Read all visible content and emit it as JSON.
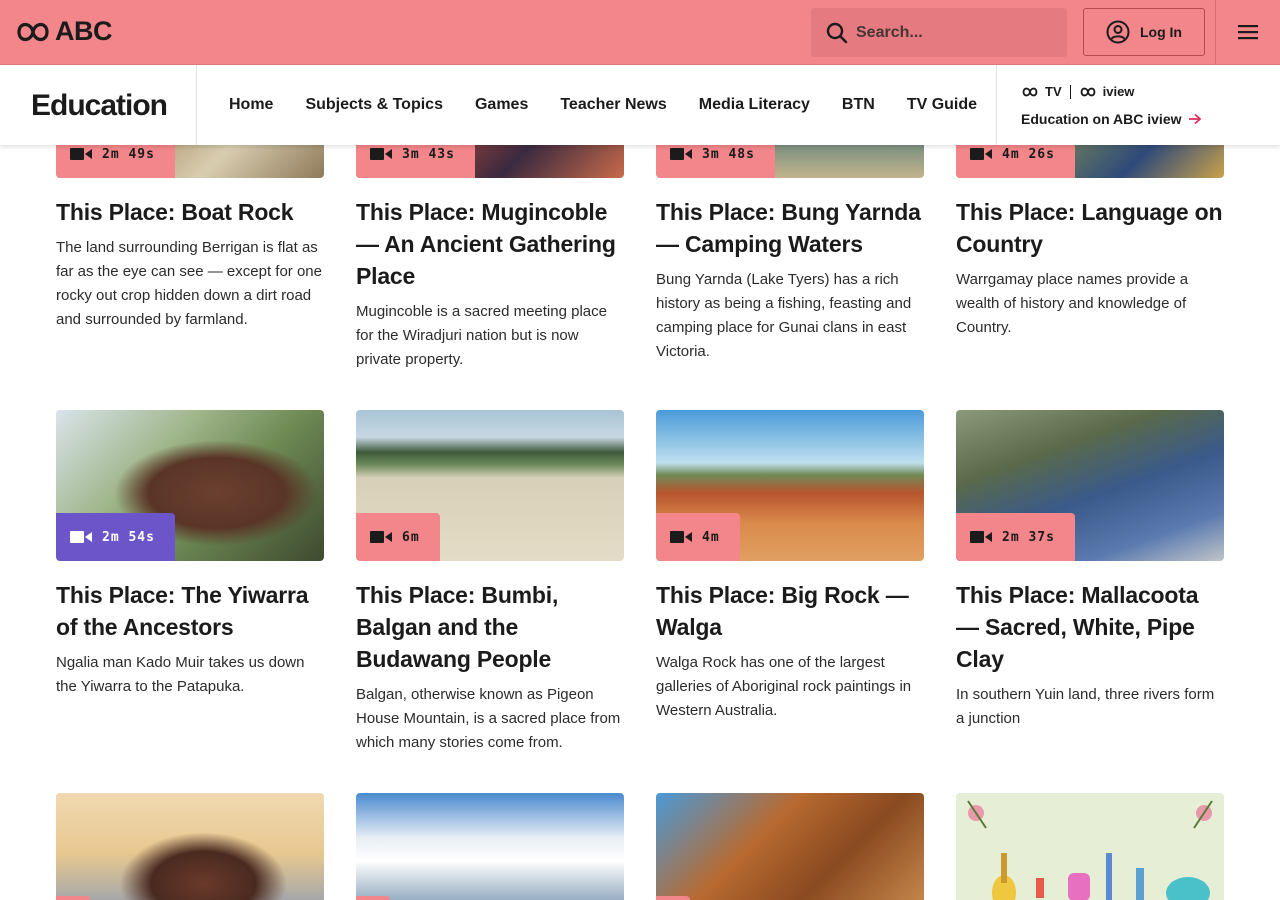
{
  "header": {
    "logo_text": "ABC",
    "search_placeholder": "Search...",
    "login_label": "Log In"
  },
  "subnav": {
    "brand": "Education",
    "links": [
      "Home",
      "Subjects & Topics",
      "Games",
      "Teacher News",
      "Media Literacy",
      "BTN",
      "TV Guide"
    ],
    "iview_tv": "TV",
    "iview_name": "iview",
    "iview_link": "Education on ABC iview"
  },
  "colors": {
    "accent": "#f2868a",
    "badge_purple": "#6b55c9",
    "text": "#1b1b1b"
  },
  "cards_row1": [
    {
      "duration": "2m 49s",
      "title": "This Place: Boat Rock",
      "desc": "The land surrounding Berrigan is flat as far as the eye can see — except for one rocky out crop hidden down a dirt road and surrounded by farmland."
    },
    {
      "duration": "3m 43s",
      "title": "This Place: Mugincoble — An Ancient Gathering Place",
      "desc": "Mugincoble is a sacred meeting place for the Wiradjuri nation but is now private property."
    },
    {
      "duration": "3m 48s",
      "title": "This Place: Bung Yarnda — Camping Waters",
      "desc": "Bung Yarnda (Lake Tyers) has a rich history as being a fishing, feasting and camping place for Gunai clans in east Victoria."
    },
    {
      "duration": "4m 26s",
      "title": "This Place: Language on Country",
      "desc": "Warrgamay place names provide a wealth of history and knowledge of Country."
    }
  ],
  "cards_row2": [
    {
      "duration": "2m 54s",
      "title": "This Place: The Yiwarra of the Ancestors",
      "desc": "Ngalia man Kado Muir takes us down the Yiwarra to the Patapuka."
    },
    {
      "duration": "6m",
      "title": "This Place: Bumbi, Balgan and the Budawang People",
      "desc": "Balgan, otherwise known as Pigeon House Mountain, is a sacred place from which many stories come from."
    },
    {
      "duration": "4m",
      "title": "This Place: Big Rock — Walga",
      "desc": "Walga Rock has one of the largest galleries of Aboriginal rock paintings in Western Australia."
    },
    {
      "duration": "2m 37s",
      "title": "This Place: Mallacoota — Sacred, White, Pipe Clay",
      "desc": "In southern Yuin land, three rivers form a junction"
    }
  ]
}
